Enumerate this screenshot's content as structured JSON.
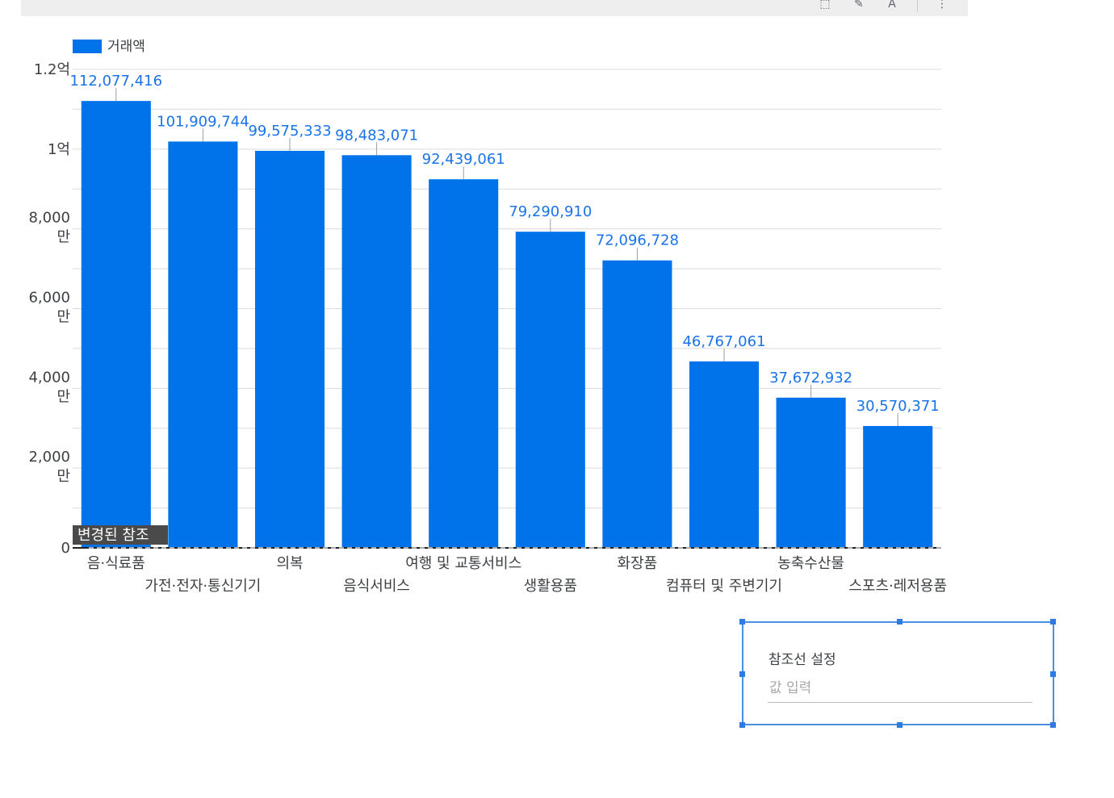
{
  "chart_data": {
    "type": "bar",
    "categories": [
      "음·식료품",
      "가전·전자·통신기기",
      "의복",
      "음식서비스",
      "여행 및 교통서비스",
      "생활용품",
      "화장품",
      "컴퓨터 및 주변기기",
      "농축수산물",
      "스포츠·레저용품"
    ],
    "series": [
      {
        "name": "거래액",
        "values": [
          112077416,
          101909744,
          99575333,
          98483071,
          92439061,
          79290910,
          72096728,
          46767061,
          37672932,
          30570371
        ],
        "labels": [
          "112,077,416",
          "101,909,744",
          "99,575,333",
          "98,483,071",
          "92,439,061",
          "79,290,910",
          "72,096,728",
          "46,767,061",
          "37,672,932",
          "30,570,371"
        ],
        "color": "#0073eb"
      }
    ],
    "ylim": [
      0,
      120000000
    ],
    "yticks": [
      {
        "value": 0,
        "label": [
          "0"
        ]
      },
      {
        "value": 20000000,
        "label": [
          "2,000",
          "만"
        ]
      },
      {
        "value": 40000000,
        "label": [
          "4,000",
          "만"
        ]
      },
      {
        "value": 60000000,
        "label": [
          "6,000",
          "만"
        ]
      },
      {
        "value": 80000000,
        "label": [
          "8,000",
          "만"
        ]
      },
      {
        "value": 100000000,
        "label": [
          "1억"
        ]
      },
      {
        "value": 120000000,
        "label": [
          "1.2억"
        ]
      }
    ],
    "gridlines": true,
    "legend_position": "top-left",
    "reference_line": {
      "value": 0,
      "label": "변경된 참조"
    }
  },
  "colors": {
    "bar": "#0073eb",
    "data_label": "#1a73e8",
    "axis_text": "#3c4043",
    "grid": "#dcdcdc"
  },
  "toolbar": {
    "icons": [
      "select-area-icon",
      "pencil-icon",
      "sort-az-icon",
      "more-vert-icon"
    ]
  },
  "ref_panel": {
    "title": "참조선 설정",
    "placeholder": "값 입력"
  }
}
